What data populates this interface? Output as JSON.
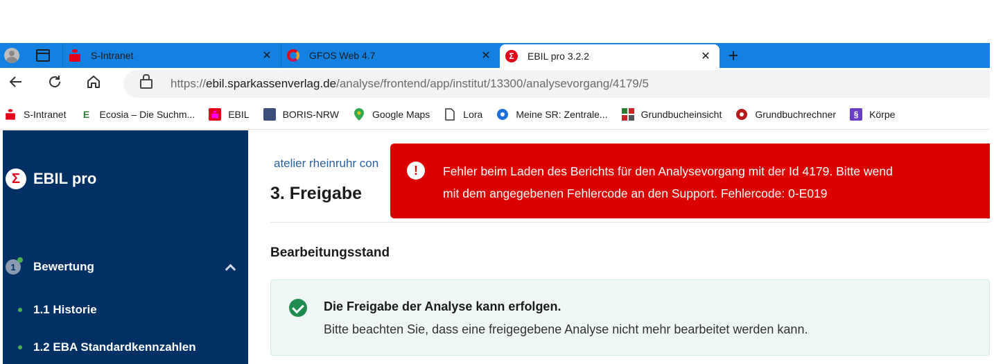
{
  "browser": {
    "tabs": [
      {
        "title": "S-Intranet",
        "icon": "sparkasse-icon"
      },
      {
        "title": "GFOS Web 4.7",
        "icon": "gfos-icon"
      },
      {
        "title": "EBIL pro 3.2.2",
        "icon": "sigma-icon",
        "active": true
      }
    ],
    "close_glyph": "✕",
    "new_tab_glyph": "+",
    "url_prefix": "https://",
    "url_host": "ebil.sparkassenverlag.de",
    "url_path": "/analyse/frontend/app/institut/13300/analysevorgang/4179/5",
    "bookmarks": [
      {
        "label": "S-Intranet",
        "icon": "sparkasse-icon"
      },
      {
        "label": "Ecosia – Die Suchm...",
        "icon": "ecosia-icon"
      },
      {
        "label": "EBIL",
        "icon": "sparkasse-icon"
      },
      {
        "label": "BORIS-NRW",
        "icon": "boris-icon"
      },
      {
        "label": "Google Maps",
        "icon": "map-pin-icon"
      },
      {
        "label": "Lora",
        "icon": "document-icon"
      },
      {
        "label": "Meine SR: Zentrale...",
        "icon": "sr-icon"
      },
      {
        "label": "Grundbucheinsicht",
        "icon": "grundbuch-icon"
      },
      {
        "label": "Grundbuchrechner",
        "icon": "target-icon"
      },
      {
        "label": "Körpe",
        "icon": "paragraph-icon"
      }
    ]
  },
  "app": {
    "brand": "EBIL pro",
    "logo_glyph": "Σ",
    "nav": {
      "section_step": "1",
      "section_label": "Bewertung",
      "items": [
        "1.1 Historie",
        "1.2 EBA Standardkennzahlen"
      ]
    }
  },
  "main": {
    "breadcrumb": "atelier rheinruhr con",
    "title": "3. Freigabe",
    "section_title": "Bearbeitungsstand",
    "status": {
      "title": "Die Freigabe der Analyse kann erfolgen.",
      "text": "Bitte beachten Sie, dass eine freigegebene Analyse nicht mehr bearbeitet werden kann."
    }
  },
  "error": {
    "icon_glyph": "!",
    "line1": "Fehler beim Laden des Berichts für den Analysevorgang mit der Id 4179. Bitte wend",
    "line2": "mit dem angegebenen Fehlercode an den Support. Fehlercode: 0-E019"
  },
  "colors": {
    "tabbar": "#1480e0",
    "sidebar": "#003064",
    "error": "#dc0000",
    "success": "#1e8c4e",
    "sparkasse_red": "#e2001a"
  }
}
